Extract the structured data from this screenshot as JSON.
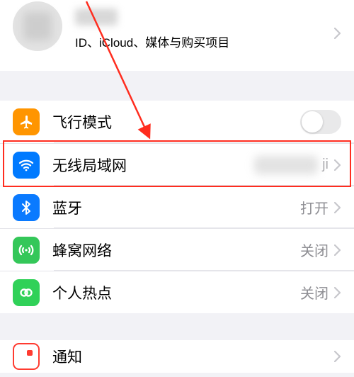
{
  "profile": {
    "subtitle": "ID、iCloud、媒体与购买项目"
  },
  "network": {
    "airplane": {
      "label": "飞行模式",
      "toggle": false
    },
    "wifi": {
      "label": "无线局域网",
      "value_suffix": "ji"
    },
    "bluetooth": {
      "label": "蓝牙",
      "value": "打开"
    },
    "cellular": {
      "label": "蜂窝网络",
      "value": "关闭"
    },
    "hotspot": {
      "label": "个人热点",
      "value": "关闭"
    }
  },
  "notifications": {
    "label": "通知"
  }
}
